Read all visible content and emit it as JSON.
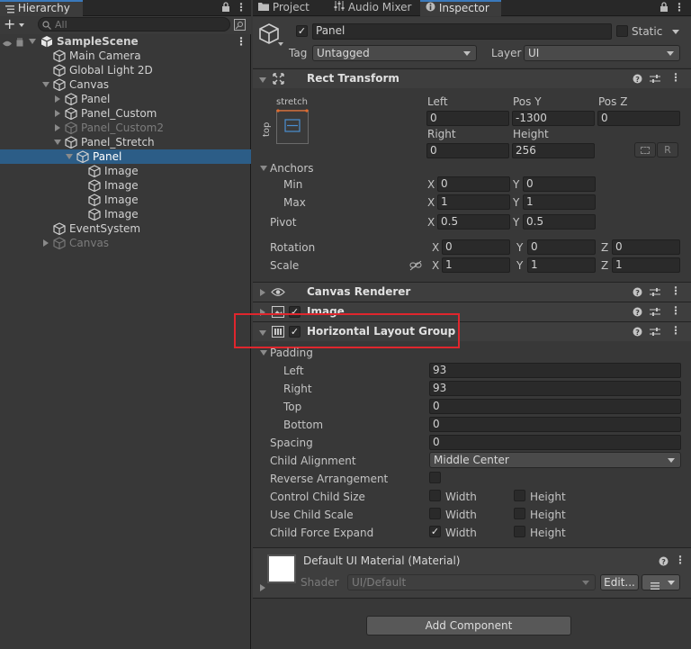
{
  "tabs": {
    "hierarchy": "Hierarchy",
    "project": "Project",
    "audio_mixer": "Audio Mixer",
    "inspector": "Inspector"
  },
  "hierarchy": {
    "search_placeholder": "All",
    "items": [
      {
        "label": "SampleScene",
        "indent": 0,
        "type": "scene",
        "expand": "down"
      },
      {
        "label": "Main Camera",
        "indent": 1,
        "type": "obj",
        "expand": ""
      },
      {
        "label": "Global Light 2D",
        "indent": 1,
        "type": "obj",
        "expand": ""
      },
      {
        "label": "Canvas",
        "indent": 1,
        "type": "obj",
        "expand": "down"
      },
      {
        "label": "Panel",
        "indent": 2,
        "type": "obj",
        "expand": "right"
      },
      {
        "label": "Panel_Custom",
        "indent": 2,
        "type": "obj",
        "expand": "right"
      },
      {
        "label": "Panel_Custom2",
        "indent": 2,
        "type": "obj",
        "expand": "right",
        "dim": true
      },
      {
        "label": "Panel_Stretch",
        "indent": 2,
        "type": "obj",
        "expand": "down"
      },
      {
        "label": "Panel",
        "indent": 3,
        "type": "obj",
        "expand": "down",
        "selected": true
      },
      {
        "label": "Image",
        "indent": 4,
        "type": "obj",
        "expand": ""
      },
      {
        "label": "Image",
        "indent": 4,
        "type": "obj",
        "expand": ""
      },
      {
        "label": "Image",
        "indent": 4,
        "type": "obj",
        "expand": ""
      },
      {
        "label": "Image",
        "indent": 4,
        "type": "obj",
        "expand": ""
      },
      {
        "label": "EventSystem",
        "indent": 1,
        "type": "obj",
        "expand": ""
      },
      {
        "label": "Canvas",
        "indent": 1,
        "type": "obj",
        "expand": "right",
        "dim": true
      }
    ]
  },
  "object": {
    "name": "Panel",
    "static_label": "Static",
    "tag_label": "Tag",
    "tag_value": "Untagged",
    "layer_label": "Layer",
    "layer_value": "UI"
  },
  "rect_transform": {
    "title": "Rect Transform",
    "stretch": "stretch",
    "top": "top",
    "left_label": "Left",
    "left": "0",
    "posy_label": "Pos Y",
    "posy": "-1300",
    "posz_label": "Pos Z",
    "posz": "0",
    "right_label": "Right",
    "right": "0",
    "height_label": "Height",
    "height": "256",
    "r_btn": "R",
    "anchors_label": "Anchors",
    "min_label": "Min",
    "min_x": "0",
    "min_y": "0",
    "max_label": "Max",
    "max_x": "1",
    "max_y": "1",
    "pivot_label": "Pivot",
    "pivot_x": "0.5",
    "pivot_y": "0.5",
    "rotation_label": "Rotation",
    "rot_x": "0",
    "rot_y": "0",
    "rot_z": "0",
    "scale_label": "Scale",
    "scale_x": "1",
    "scale_y": "1",
    "scale_z": "1",
    "x": "X",
    "y": "Y",
    "z": "Z"
  },
  "canvas_renderer": {
    "title": "Canvas Renderer"
  },
  "image": {
    "title": "Image"
  },
  "hlg": {
    "title": "Horizontal Layout Group",
    "padding_label": "Padding",
    "left_label": "Left",
    "left": "93",
    "right_label": "Right",
    "right": "93",
    "top_label": "Top",
    "top": "0",
    "bottom_label": "Bottom",
    "bottom": "0",
    "spacing_label": "Spacing",
    "spacing": "0",
    "child_alignment_label": "Child Alignment",
    "child_alignment": "Middle Center",
    "reverse_label": "Reverse Arrangement",
    "control_label": "Control Child Size",
    "use_scale_label": "Use Child Scale",
    "force_expand_label": "Child Force Expand",
    "width": "Width",
    "height": "Height"
  },
  "material": {
    "title": "Default UI Material (Material)",
    "shader_label": "Shader",
    "shader_value": "UI/Default",
    "edit_btn": "Edit..."
  },
  "add_component": "Add Component",
  "colors": {
    "accent": "#3a79bb",
    "selection": "#2c5d87",
    "highlight": "#e0262d"
  }
}
